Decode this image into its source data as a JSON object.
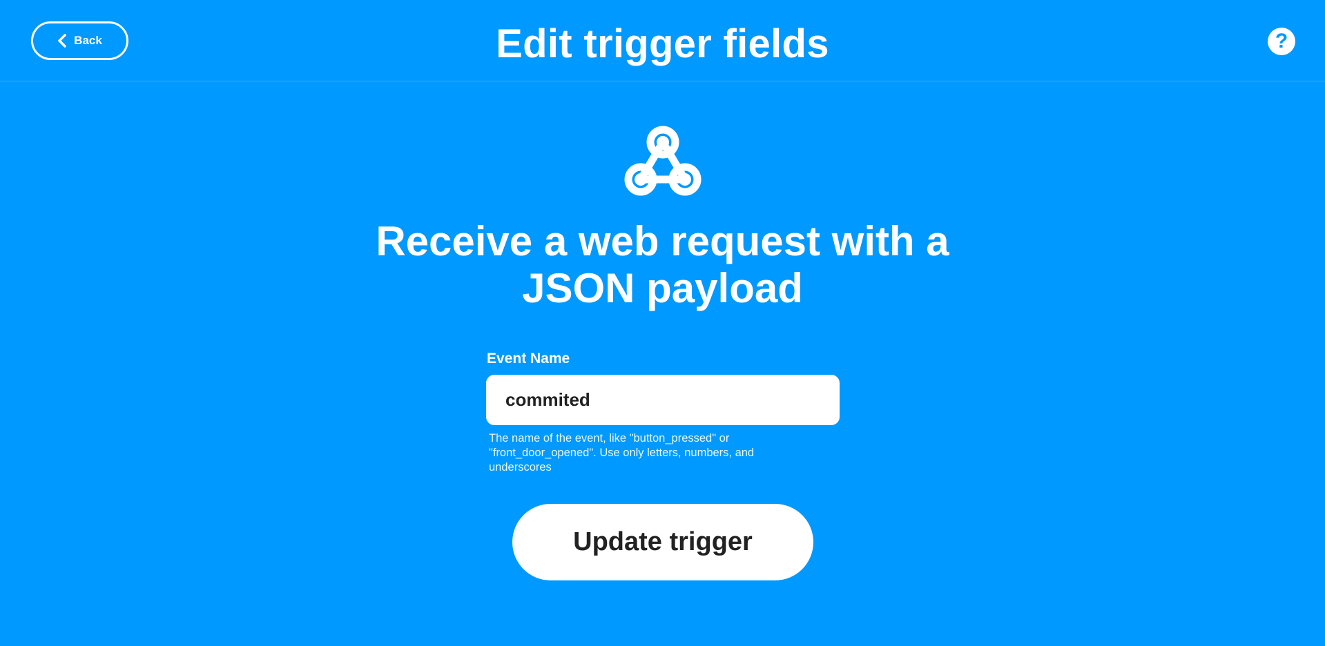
{
  "header": {
    "back_label": "Back",
    "title": "Edit trigger fields",
    "help_symbol": "?"
  },
  "service": {
    "icon": "webhooks-icon",
    "trigger_title": "Receive a web request with a JSON payload"
  },
  "form": {
    "event_name_label": "Event Name",
    "event_name_value": "commited",
    "event_name_help": "The name of the event, like \"button_pressed\" or \"front_door_opened\". Use only letters, numbers, and underscores"
  },
  "actions": {
    "update_label": "Update trigger"
  },
  "colors": {
    "background": "#0099ff",
    "foreground": "#ffffff",
    "button_text": "#222222"
  }
}
